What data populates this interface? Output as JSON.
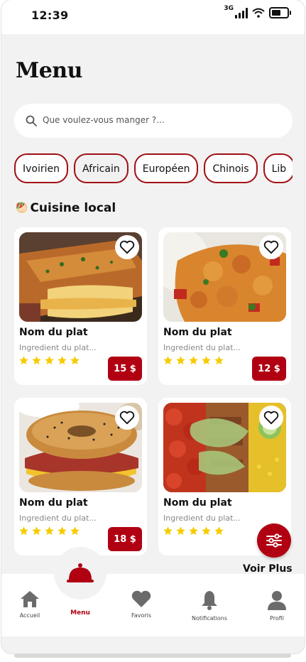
{
  "status_bar": {
    "time": "12:39",
    "network": "3G",
    "battery_percent": 60
  },
  "page": {
    "title": "Menu"
  },
  "search": {
    "placeholder": "Que voulez-vous manger ?..."
  },
  "categories": [
    {
      "label": "Ivoirien",
      "selected": false
    },
    {
      "label": "Africain",
      "selected": true
    },
    {
      "label": "Européen",
      "selected": false
    },
    {
      "label": "Chinois",
      "selected": false
    },
    {
      "label": "Lib",
      "selected": false
    }
  ],
  "section": {
    "emoji": "🥙",
    "title": "Cuisine local"
  },
  "dishes": [
    {
      "name": "Nom du plat",
      "ingredients": "Ingredient du plat...",
      "price": "15 $",
      "rating": 5,
      "image_icon": "croque-monsieur-image"
    },
    {
      "name": "Nom du plat",
      "ingredients": "Ingredient du plat...",
      "price": "12 $",
      "rating": 5,
      "image_icon": "chicken-rice-image"
    },
    {
      "name": "Nom du plat",
      "ingredients": "Ingredient du plat...",
      "price": "18 $",
      "rating": 5,
      "image_icon": "bagel-sandwich-image"
    },
    {
      "name": "Nom du plat",
      "ingredients": "Ingredient du plat...",
      "price": "",
      "rating": 5,
      "image_icon": "salad-bowl-image"
    }
  ],
  "see_more": "Voir Plus",
  "tabs": [
    {
      "label": "Accueil",
      "icon": "home-icon"
    },
    {
      "label": "Menu",
      "icon": "cloche-icon",
      "active": true
    },
    {
      "label": "Favoris",
      "icon": "heart-icon"
    },
    {
      "label": "Notifications",
      "icon": "bell-icon"
    },
    {
      "label": "Profil",
      "icon": "user-icon"
    }
  ],
  "colors": {
    "accent": "#b00012",
    "star": "#f5cc00",
    "background": "#f2f2f2"
  }
}
